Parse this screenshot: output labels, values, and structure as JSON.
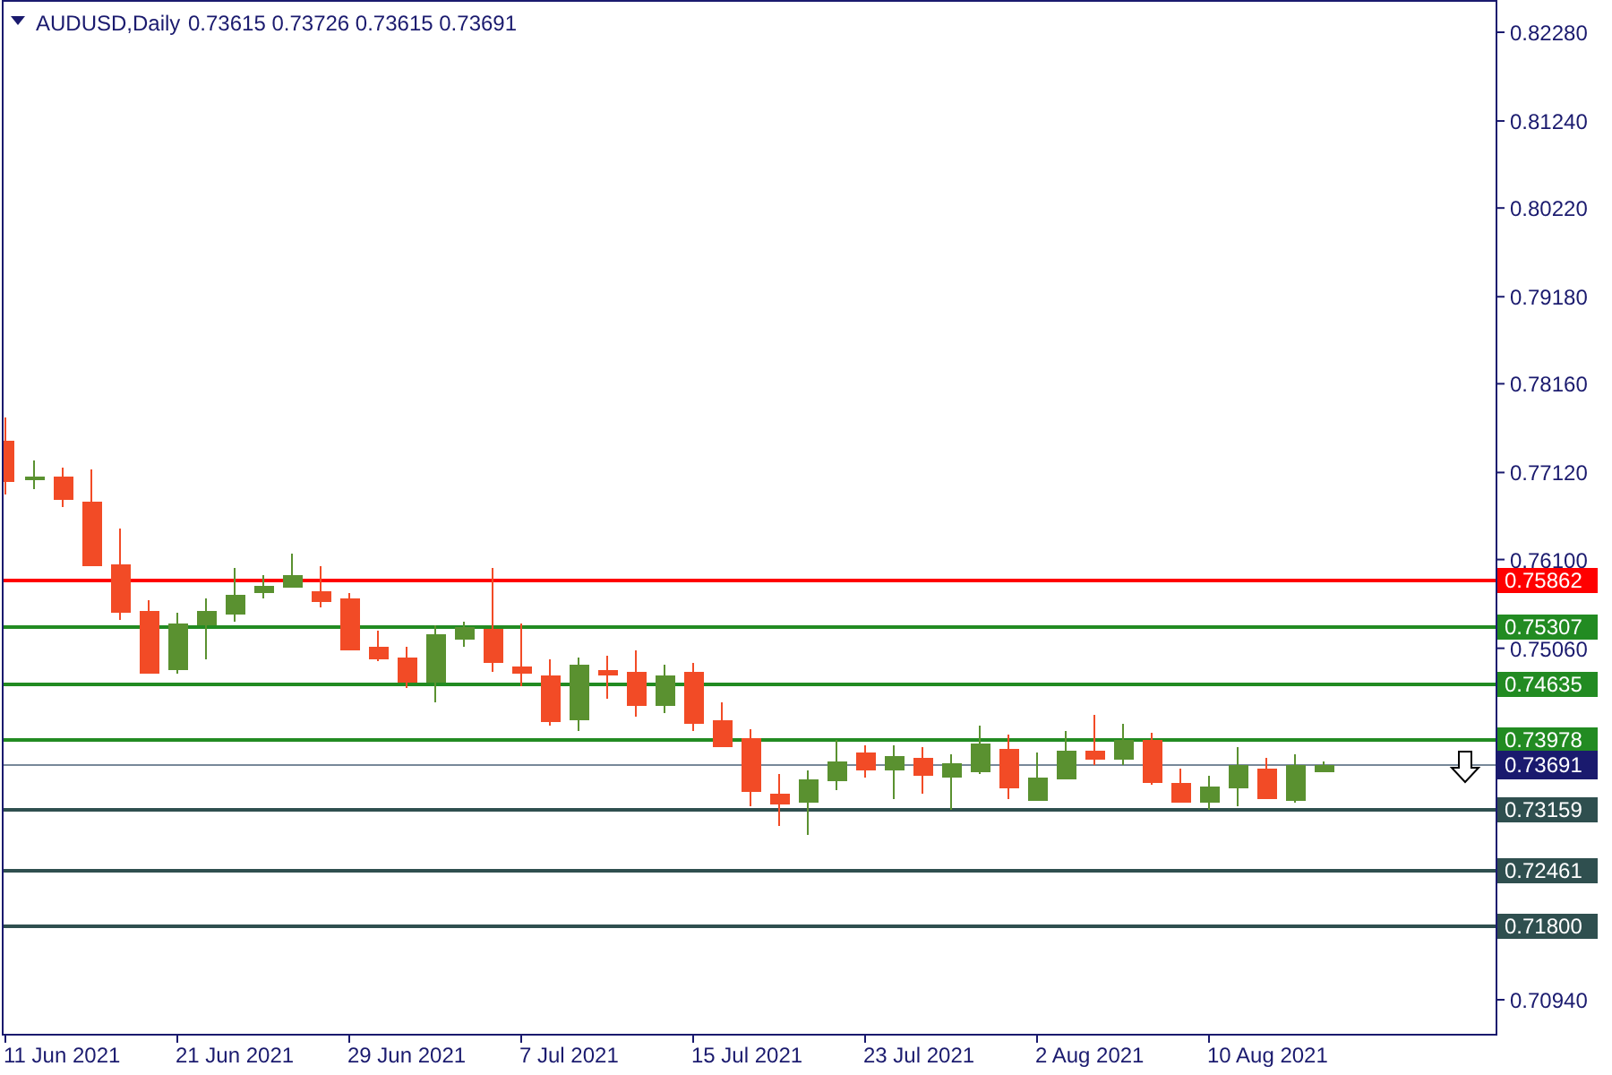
{
  "header": {
    "symbol": "AUDUSD,Daily",
    "quotes": "0.73615 0.73726 0.73615 0.73691"
  },
  "price_axis": {
    "ticks": [
      "0.82280",
      "0.81240",
      "0.80220",
      "0.79180",
      "0.78160",
      "0.77120",
      "0.76100",
      "0.75060",
      "0.70940"
    ]
  },
  "time_axis": {
    "labels": [
      "11 Jun 2021",
      "21 Jun 2021",
      "29 Jun 2021",
      "7 Jul 2021",
      "15 Jul 2021",
      "23 Jul 2021",
      "2 Aug 2021",
      "10 Aug 2021"
    ]
  },
  "levels": [
    {
      "price": "0.75862",
      "color": "#ff0000"
    },
    {
      "price": "0.75307",
      "color": "#228b22"
    },
    {
      "price": "0.74635",
      "color": "#228b22"
    },
    {
      "price": "0.73978",
      "color": "#228b22"
    },
    {
      "price": "0.73159",
      "color": "#2f4f4f"
    },
    {
      "price": "0.72461",
      "color": "#2f4f4f"
    },
    {
      "price": "0.71800",
      "color": "#2f4f4f"
    }
  ],
  "current_price": {
    "price": "0.73691"
  }
}
